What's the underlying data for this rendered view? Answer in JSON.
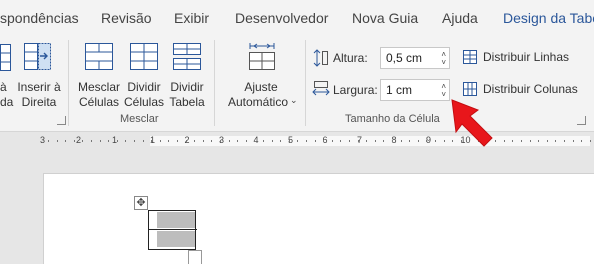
{
  "tabs": [
    {
      "label": "spondências"
    },
    {
      "label": "Revisão"
    },
    {
      "label": "Exibir"
    },
    {
      "label": "Desenvolvedor"
    },
    {
      "label": "Nova Guia"
    },
    {
      "label": "Ajuda"
    },
    {
      "label": "Design da Tabe"
    }
  ],
  "ribbon": {
    "insert_left": {
      "line1": "à",
      "line2": "da"
    },
    "insert_right": {
      "line1": "Inserir à",
      "line2": "Direita"
    },
    "merge_group": {
      "label": "Mesclar",
      "merge_cells": {
        "line1": "Mesclar",
        "line2": "Células"
      },
      "split_cells": {
        "line1": "Dividir",
        "line2": "Células"
      },
      "split_table": {
        "line1": "Dividir",
        "line2": "Tabela"
      }
    },
    "autofit": {
      "line1": "Ajuste",
      "line2": "Automático"
    },
    "cell_size": {
      "label": "Tamanho da Célula",
      "height_label": "Altura:",
      "height_value": "0,5 cm",
      "width_label": "Largura:",
      "width_value": "1 cm",
      "distribute_rows": "Distribuir Linhas",
      "distribute_columns": "Distribuir Colunas"
    }
  },
  "ruler": {
    "numbers": [
      "3",
      "2",
      "1",
      "1",
      "2",
      "3",
      "4",
      "5",
      "6",
      "7",
      "8",
      "9",
      "10"
    ]
  },
  "colors": {
    "accent": "#2b579a",
    "arrow": "#e8161b",
    "cell_fill": "#bdbdbd"
  }
}
